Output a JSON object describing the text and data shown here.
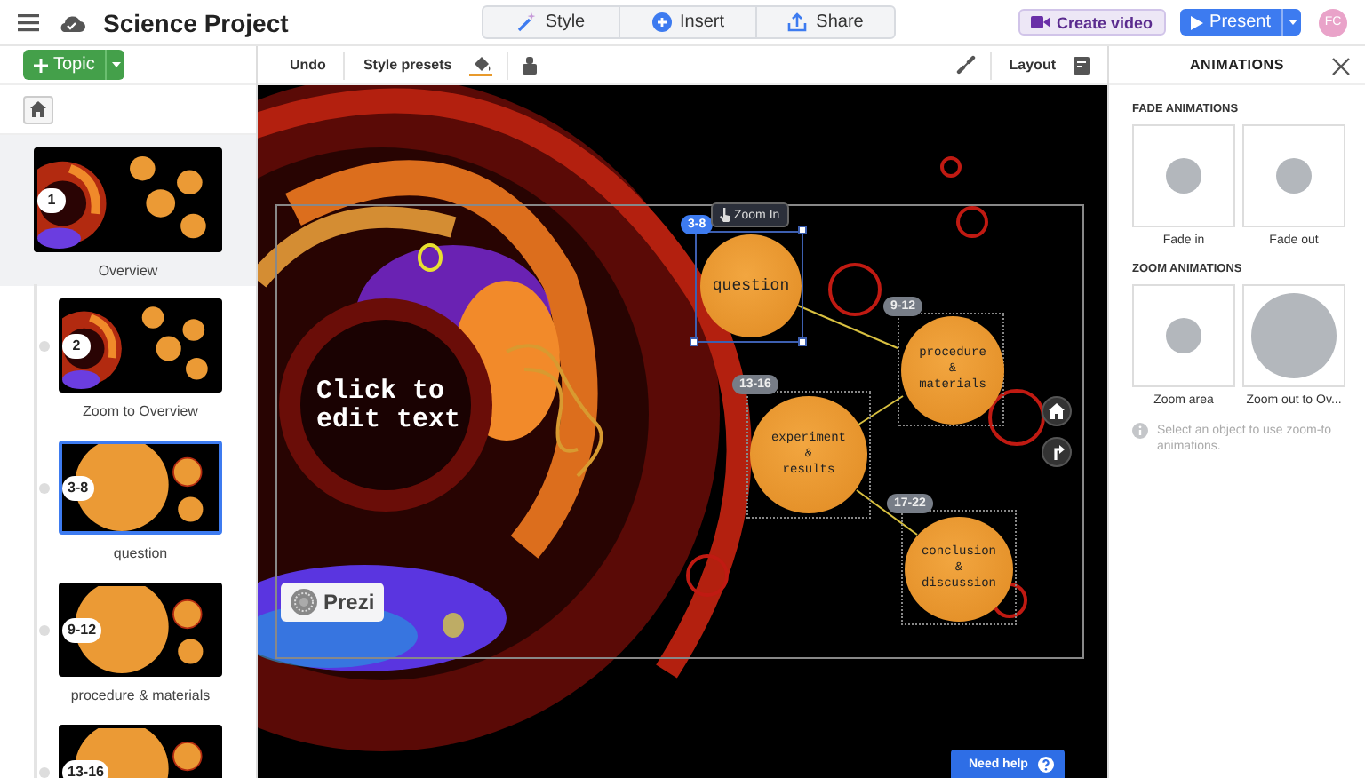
{
  "window": {
    "title": "Science Project"
  },
  "top_tabs": [
    {
      "label": "Style",
      "kind": "wand"
    },
    {
      "label": "Insert",
      "kind": "plus"
    },
    {
      "label": "Share",
      "kind": "upload"
    }
  ],
  "create_video": {
    "label": "Create video"
  },
  "present": {
    "label": "Present"
  },
  "avatar": {
    "initials": "FC"
  },
  "toolbar": {
    "topic": "Topic",
    "undo": "Undo",
    "style_presets": "Style presets",
    "layout": "Layout"
  },
  "sidebar": {
    "slides": [
      {
        "badge": "1",
        "label": "Overview",
        "selected": false,
        "kind": "overview"
      },
      {
        "badge": "2",
        "label": "Zoom to Overview",
        "selected": false,
        "kind": "overview"
      },
      {
        "badge": "3-8",
        "label": "question",
        "selected": true,
        "kind": "topic"
      },
      {
        "badge": "9-12",
        "label": "procedure & materials",
        "selected": false,
        "kind": "topic"
      },
      {
        "badge": "13-16",
        "selected": false,
        "kind": "topic"
      }
    ]
  },
  "canvas": {
    "main_text": [
      "Click to",
      "edit text"
    ],
    "logo": "Prezi",
    "tooltip": "Zoom In",
    "topics": [
      {
        "badge": "3-8",
        "lines": [
          "question"
        ],
        "selected": true
      },
      {
        "badge": "9-12",
        "lines": [
          "procedure",
          "&",
          "materials"
        ],
        "selected": false
      },
      {
        "badge": "13-16",
        "lines": [
          "experiment",
          "&",
          "results"
        ],
        "selected": false
      },
      {
        "badge": "17-22",
        "lines": [
          "conclusion",
          "&",
          "discussion"
        ],
        "selected": false
      }
    ],
    "help": "Need help"
  },
  "animations": {
    "title": "ANIMATIONS",
    "groups": [
      {
        "heading": "FADE ANIMATIONS",
        "items": [
          {
            "label": "Fade in",
            "kind": "dot"
          },
          {
            "label": "Fade out",
            "kind": "dot"
          }
        ]
      },
      {
        "heading": "ZOOM ANIMATIONS",
        "items": [
          {
            "label": "Zoom area",
            "kind": "dot"
          },
          {
            "label": "Zoom out to Ov...",
            "kind": "full"
          }
        ]
      }
    ],
    "hint": "Select an object to use zoom-to animations."
  }
}
